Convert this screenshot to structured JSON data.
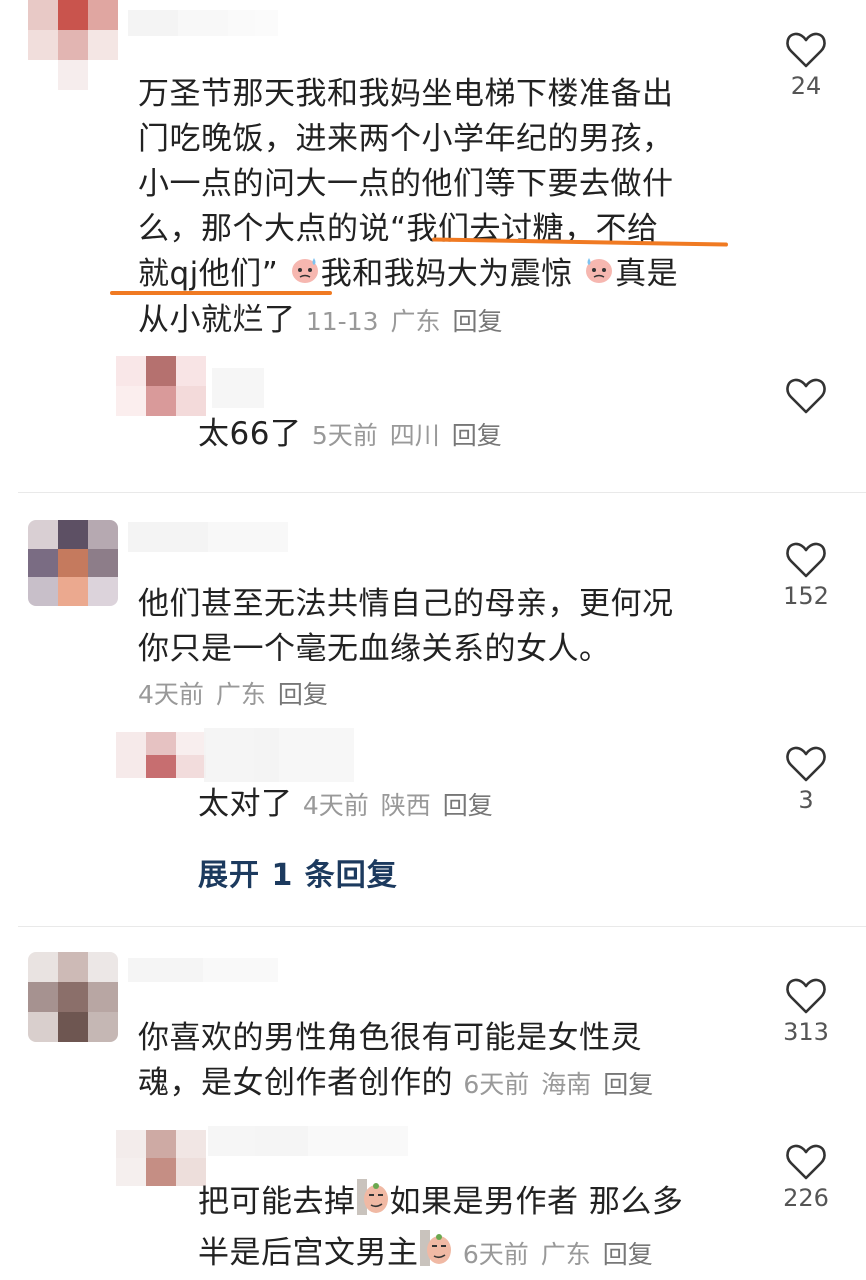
{
  "comments": [
    {
      "text_lines": [
        "万圣节那天我和我妈坐电梯下楼准备出",
        "门吃晚饭，进来两个小学年纪的男孩，",
        "小一点的问大一点的他们等下要去做什",
        "么，那个大点的说“我们去讨糖，不给",
        "就qj他们”",
        "我和我妈大为震惊",
        "真是",
        "从小就烂了"
      ],
      "time": "11-13",
      "location": "广东",
      "reply_label": "回复",
      "likes": "24",
      "reply": {
        "text": "太66了",
        "time": "5天前",
        "location": "四川",
        "reply_label": "回复",
        "likes": ""
      }
    },
    {
      "text_lines": [
        "他们甚至无法共情自己的母亲，更何况",
        "你只是一个毫无血缘关系的女人。"
      ],
      "time": "4天前",
      "location": "广东",
      "reply_label": "回复",
      "likes": "152",
      "reply": {
        "text": "太对了",
        "time": "4天前",
        "location": "陕西",
        "reply_label": "回复",
        "likes": "3"
      },
      "expand_label": "展开 1 条回复"
    },
    {
      "text_lines": [
        "你喜欢的男性角色很有可能是女性灵",
        "魂，是女创作者创作的"
      ],
      "time": "6天前",
      "location": "海南",
      "reply_label": "回复",
      "likes": "313",
      "reply": {
        "text_lines": [
          "把可能去掉",
          "如果是男作者 那么多",
          "半是后宫文男主"
        ],
        "time": "6天前",
        "location": "广东",
        "reply_label": "回复",
        "likes": "226"
      }
    }
  ],
  "icons": {
    "like": "heart-outline-icon",
    "emoji_sweat": "sweat-face-emoji",
    "emoji_smirk": "smirk-face-emoji"
  },
  "colors": {
    "highlight_underline": "#f07a22",
    "expand_link": "#1c3a5e",
    "meta": "#999999"
  }
}
